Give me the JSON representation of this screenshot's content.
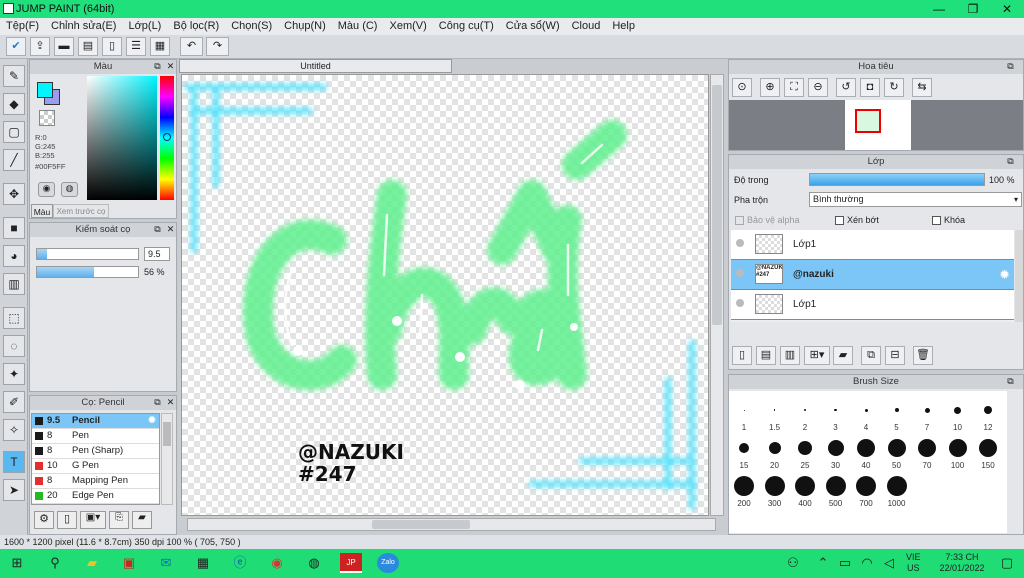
{
  "app": {
    "title": "JUMP PAINT (64bit)",
    "minimize": "—",
    "maximize": "❐",
    "close": "✕"
  },
  "menu": [
    "Tệp(F)",
    "Chỉnh sửa(E)",
    "Lớp(L)",
    "Bộ lọc(R)",
    "Chọn(S)",
    "Chụp(N)",
    "Màu (C)",
    "Xem(V)",
    "Công cụ(T)",
    "Cửa sổ(W)",
    "Cloud",
    "Help"
  ],
  "toolbar": {
    "undo": "↶",
    "redo": "↷"
  },
  "color_panel": {
    "title": "Màu",
    "r": "R:0",
    "g": "G:245",
    "b": "B:255",
    "hex": "#00F5FF",
    "tab_color": "Màu",
    "tab_history": "Xem trước cọ",
    "main_color": "#00f5ff"
  },
  "brush_control": {
    "title": "Kiểm soát cọ",
    "size": "9.5",
    "opacity": "56 %",
    "size_fraction": 0.1,
    "opacity_fraction": 0.56
  },
  "brush_panel": {
    "title": "Cọ: Pencil",
    "items": [
      {
        "size": "9.5",
        "name": "Pencil",
        "color": "#1a1a1a",
        "selected": true
      },
      {
        "size": "8",
        "name": "Pen",
        "color": "#1a1a1a"
      },
      {
        "size": "8",
        "name": "Pen (Sharp)",
        "color": "#1a1a1a"
      },
      {
        "size": "10",
        "name": "G Pen",
        "color": "#e23030"
      },
      {
        "size": "8",
        "name": "Mapping Pen",
        "color": "#e23030"
      },
      {
        "size": "20",
        "name": "Edge Pen",
        "color": "#22bb22"
      }
    ]
  },
  "document": {
    "tab": "Untitled",
    "watermark_name": "@NAZUKI",
    "watermark_num": "#247"
  },
  "navigator": {
    "title": "Hoa tiêu"
  },
  "layer_panel": {
    "title": "Lớp",
    "opacity_label": "Độ trong",
    "opacity_value": "100 %",
    "opacity_fraction": 1.0,
    "blend_label": "Pha trộn",
    "blend_value": "Bình thường",
    "protect_alpha": "Bảo vệ alpha",
    "clip": "Xén bớt",
    "lock": "Khóa",
    "layers": [
      {
        "name": "Lớp1",
        "selected": false
      },
      {
        "name": "@nazuki",
        "selected": true,
        "thumb_text": "@NAZUKI #247"
      },
      {
        "name": "Lớp1",
        "selected": false
      }
    ]
  },
  "brush_size_panel": {
    "title": "Brush Size",
    "sizes": [
      "1",
      "1.5",
      "2",
      "3",
      "4",
      "5",
      "7",
      "10",
      "12",
      "15",
      "20",
      "25",
      "30",
      "40",
      "50",
      "70",
      "100",
      "150",
      "200",
      "300",
      "400",
      "500",
      "700",
      "1000"
    ]
  },
  "status": {
    "dimensions": "1600 * 1200 pixel",
    "physical": "(11.6 * 8.7cm)",
    "dpi": "350 dpi",
    "zoom": "100 %",
    "coords": "( 705, 750 )"
  },
  "taskbar": {
    "lang": "VIE",
    "region": "US",
    "time": "7:33 CH",
    "date": "22/01/2022"
  }
}
